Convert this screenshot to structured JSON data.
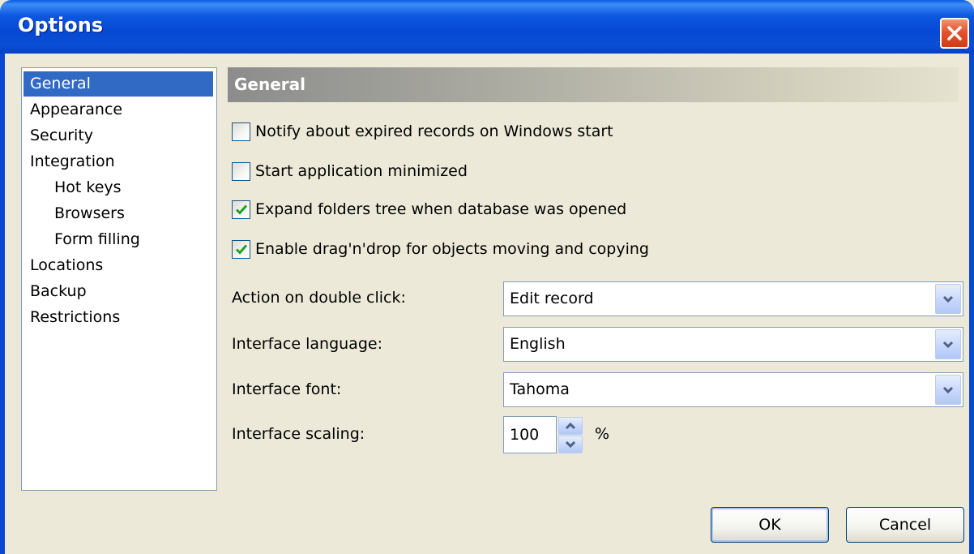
{
  "window": {
    "title": "Options"
  },
  "nav": {
    "items": [
      {
        "label": "General",
        "selected": true,
        "indent": 0
      },
      {
        "label": "Appearance",
        "selected": false,
        "indent": 0
      },
      {
        "label": "Security",
        "selected": false,
        "indent": 0
      },
      {
        "label": "Integration",
        "selected": false,
        "indent": 0
      },
      {
        "label": "Hot keys",
        "selected": false,
        "indent": 1
      },
      {
        "label": "Browsers",
        "selected": false,
        "indent": 1
      },
      {
        "label": "Form filling",
        "selected": false,
        "indent": 1
      },
      {
        "label": "Locations",
        "selected": false,
        "indent": 0
      },
      {
        "label": "Backup",
        "selected": false,
        "indent": 0
      },
      {
        "label": "Restrictions",
        "selected": false,
        "indent": 0
      }
    ]
  },
  "section": {
    "title": "General"
  },
  "options": [
    {
      "label": "Notify about expired records on Windows start",
      "checked": false
    },
    {
      "label": "Start application minimized",
      "checked": false
    },
    {
      "label": "Expand folders tree when database was opened",
      "checked": true
    },
    {
      "label": "Enable drag'n'drop for objects moving and copying",
      "checked": true
    }
  ],
  "fields": {
    "double_click": {
      "label": "Action on double click:",
      "value": "Edit record"
    },
    "language": {
      "label": "Interface language:",
      "value": "English"
    },
    "font": {
      "label": "Interface font:",
      "value": "Tahoma"
    },
    "scaling": {
      "label": "Interface scaling:",
      "value": "100",
      "unit": "%"
    }
  },
  "buttons": {
    "ok": "OK",
    "cancel": "Cancel"
  },
  "colors": {
    "titlebar": "#0a4fd6",
    "selection": "#316ac5",
    "checkmark": "#21a121",
    "face": "#ece9d8"
  },
  "icons": {
    "close": "close-icon",
    "dropdown": "chevron-down-icon",
    "spin_up": "arrow-up-icon",
    "spin_down": "arrow-down-icon",
    "check": "checkmark-icon"
  }
}
